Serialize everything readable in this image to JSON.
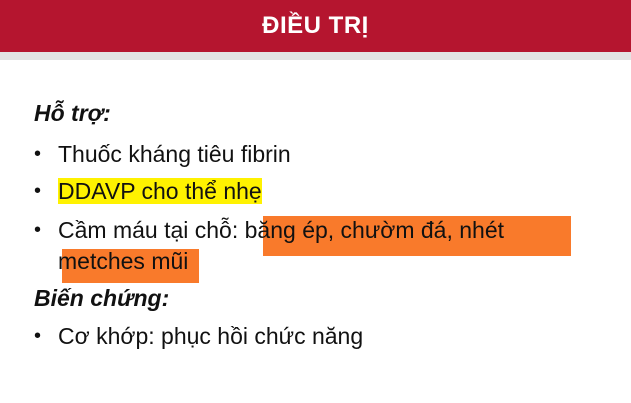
{
  "header": {
    "title": "ĐIỀU TRỊ",
    "color": "#b5152f"
  },
  "sections": {
    "support": {
      "heading": "Hỗ trợ:",
      "items": [
        "Thuốc kháng tiêu fibrin",
        "DDAVP cho thể nhẹ",
        "Cầm máu tại chỗ: ",
        "băng ép, chườm đá, nhét",
        "metches mũi"
      ]
    },
    "complications": {
      "heading": "Biến chứng:",
      "items": [
        "Cơ khớp: phục hồi chức năng"
      ]
    }
  },
  "highlight_colors": {
    "yellow": "#fff200",
    "orange": "#f97a2b"
  },
  "bullet_symbol": "•"
}
